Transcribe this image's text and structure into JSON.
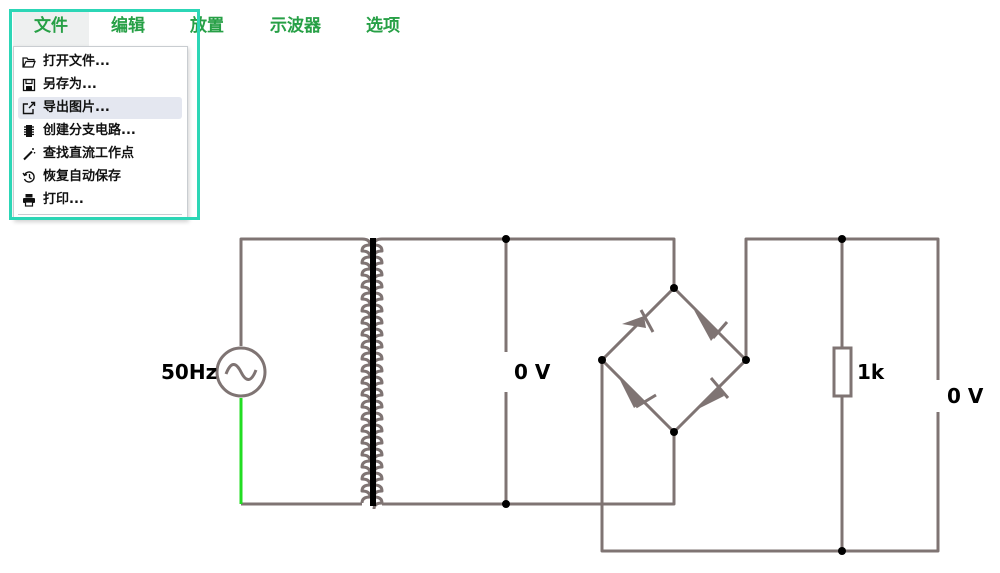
{
  "menubar": {
    "items": [
      {
        "label": "文件"
      },
      {
        "label": "编辑"
      },
      {
        "label": "放置"
      },
      {
        "label": "示波器"
      },
      {
        "label": "选项"
      }
    ]
  },
  "file_menu": {
    "items": [
      {
        "label": "打开文件...",
        "icon": "folder-open-icon"
      },
      {
        "label": "另存为...",
        "icon": "floppy-disk-icon"
      },
      {
        "label": "导出图片...",
        "icon": "export-icon"
      },
      {
        "label": "创建分支电路...",
        "icon": "chip-icon"
      },
      {
        "label": "查找直流工作点",
        "icon": "magic-wand-icon"
      },
      {
        "label": "恢复自动保存",
        "icon": "history-icon"
      },
      {
        "label": "打印...",
        "icon": "printer-icon"
      }
    ]
  },
  "circuit": {
    "source_label": "50Hz",
    "voltage_label_1": "0 V",
    "resistor_label": "1k",
    "voltage_label_2": "0 V"
  },
  "colors": {
    "menu_text": "#27a046",
    "wire": "#7f7473",
    "ground_wire": "#22dd22",
    "highlight": "#2cd6b6"
  }
}
